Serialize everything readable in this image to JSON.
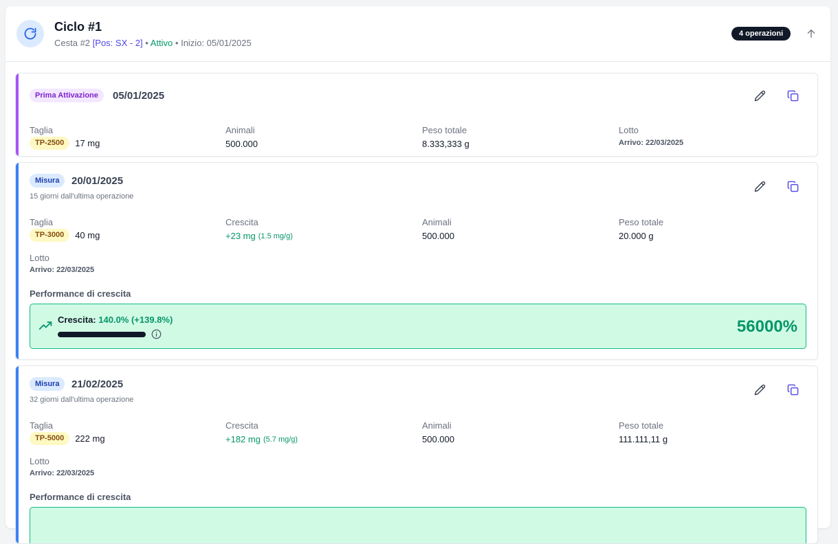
{
  "header": {
    "title": "Ciclo #1",
    "cesta": "Cesta #2",
    "position": "[Pos: SX - 2]",
    "sep1": "•",
    "status": "Attivo",
    "sep2": "•",
    "start": "Inizio: 05/01/2025",
    "ops_badge": "4 operazioni"
  },
  "operations": [
    {
      "type": "Prima Attivazione",
      "date": "05/01/2025",
      "accent": "#a855f7",
      "fields": {
        "taglia_label": "Taglia",
        "taglia_code": "TP-2500",
        "taglia_value": "17 mg",
        "animali_label": "Animali",
        "animali_value": "500.000",
        "peso_label": "Peso totale",
        "peso_value": "8.333,333 g",
        "lotto_label": "Lotto",
        "lotto_value": "Arrivo: 22/03/2025"
      }
    },
    {
      "type": "Misura",
      "date": "20/01/2025",
      "since": "15 giorni dall'ultima operazione",
      "accent": "#3b82f6",
      "fields": {
        "taglia_label": "Taglia",
        "taglia_code": "TP-3000",
        "taglia_value": "40 mg",
        "crescita_label": "Crescita",
        "crescita_value": "+23 mg",
        "crescita_rate": "(1.5 mg/g)",
        "animali_label": "Animali",
        "animali_value": "500.000",
        "peso_label": "Peso totale",
        "peso_value": "20.000 g",
        "lotto_label": "Lotto",
        "lotto_value": "Arrivo: 22/03/2025"
      },
      "performance": {
        "title": "Performance di crescita",
        "label": "Crescita:",
        "value": "140.0% (+139.8%)",
        "big": "56000%"
      }
    },
    {
      "type": "Misura",
      "date": "21/02/2025",
      "since": "32 giorni dall'ultima operazione",
      "accent": "#3b82f6",
      "fields": {
        "taglia_label": "Taglia",
        "taglia_code": "TP-5000",
        "taglia_value": "222 mg",
        "crescita_label": "Crescita",
        "crescita_value": "+182 mg",
        "crescita_rate": "(5.7 mg/g)",
        "animali_label": "Animali",
        "animali_value": "500.000",
        "peso_label": "Peso totale",
        "peso_value": "111.111,11 g",
        "lotto_label": "Lotto",
        "lotto_value": "Arrivo: 22/03/2025"
      },
      "performance": {
        "title": "Performance di crescita"
      }
    }
  ],
  "icons": {
    "cycle": "refresh-icon",
    "collapse": "arrow-up-icon",
    "edit": "pencil-icon",
    "duplicate": "copy-icon",
    "trend": "trending-up-icon",
    "info": "info-icon"
  }
}
